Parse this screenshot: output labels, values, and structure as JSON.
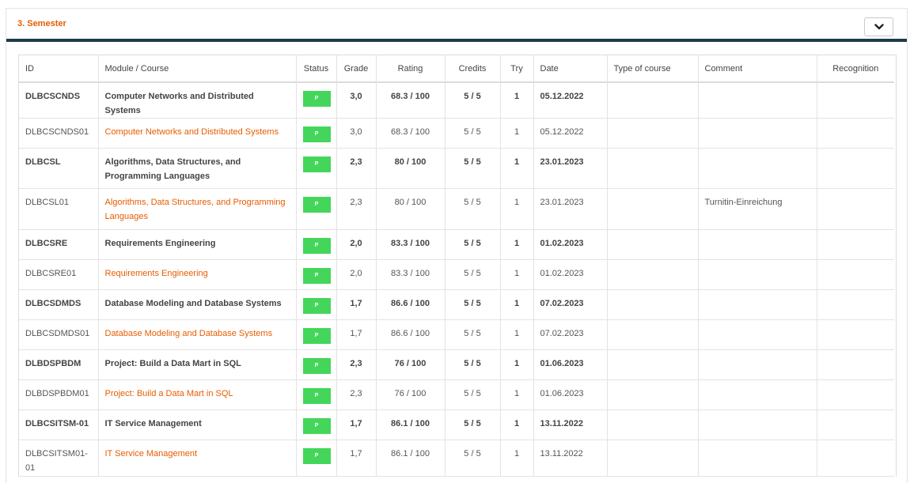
{
  "panel": {
    "title": "3. Semester"
  },
  "columns": {
    "id": "ID",
    "module": "Module / Course",
    "status": "Status",
    "grade": "Grade",
    "rating": "Rating",
    "credits": "Credits",
    "try": "Try",
    "date": "Date",
    "type": "Type of course",
    "comment": "Comment",
    "recognition": "Recognition"
  },
  "colors": {
    "accent": "#e65c00",
    "header_rule": "#1d3c4a",
    "status_passed": "#44d65a"
  },
  "rows": [
    {
      "kind": "module",
      "id": "DLBCSCNDS",
      "name": "Computer Networks and Distributed Systems",
      "status": "P",
      "grade": "3,0",
      "rating": "68.3 / 100",
      "credits": "5 / 5",
      "try": "1",
      "date": "05.12.2022",
      "type": "",
      "comment": "",
      "recognition": ""
    },
    {
      "kind": "course",
      "id": "DLBCSCNDS01",
      "name": "Computer Networks and Distributed Systems",
      "status": "P",
      "grade": "3,0",
      "rating": "68.3 / 100",
      "credits": "5 / 5",
      "try": "1",
      "date": "05.12.2022",
      "type": "",
      "comment": "",
      "recognition": ""
    },
    {
      "kind": "module",
      "id": "DLBCSL",
      "name": "Algorithms, Data Structures, and Programming Languages",
      "status": "P",
      "grade": "2,3",
      "rating": "80 / 100",
      "credits": "5 / 5",
      "try": "1",
      "date": "23.01.2023",
      "type": "",
      "comment": "",
      "recognition": ""
    },
    {
      "kind": "course",
      "id": "DLBCSL01",
      "name": "Algorithms, Data Structures, and Programming Languages",
      "status": "P",
      "grade": "2,3",
      "rating": "80 / 100",
      "credits": "5 / 5",
      "try": "1",
      "date": "23.01.2023",
      "type": "",
      "comment": "Turnitin-Einreichung",
      "recognition": ""
    },
    {
      "kind": "module",
      "id": "DLBCSRE",
      "name": "Requirements Engineering",
      "status": "P",
      "grade": "2,0",
      "rating": "83.3 / 100",
      "credits": "5 / 5",
      "try": "1",
      "date": "01.02.2023",
      "type": "",
      "comment": "",
      "recognition": ""
    },
    {
      "kind": "course",
      "id": "DLBCSRE01",
      "name": "Requirements Engineering",
      "status": "P",
      "grade": "2,0",
      "rating": "83.3 / 100",
      "credits": "5 / 5",
      "try": "1",
      "date": "01.02.2023",
      "type": "",
      "comment": "",
      "recognition": ""
    },
    {
      "kind": "module",
      "id": "DLBCSDMDS",
      "name": "Database Modeling and Database Systems",
      "status": "P",
      "grade": "1,7",
      "rating": "86.6 / 100",
      "credits": "5 / 5",
      "try": "1",
      "date": "07.02.2023",
      "type": "",
      "comment": "",
      "recognition": ""
    },
    {
      "kind": "course",
      "id": "DLBCSDMDS01",
      "name": "Database Modeling and Database Systems",
      "status": "P",
      "grade": "1,7",
      "rating": "86.6 / 100",
      "credits": "5 / 5",
      "try": "1",
      "date": "07.02.2023",
      "type": "",
      "comment": "",
      "recognition": ""
    },
    {
      "kind": "module",
      "id": "DLBDSPBDM",
      "name": "Project: Build a Data Mart in SQL",
      "status": "P",
      "grade": "2,3",
      "rating": "76 / 100",
      "credits": "5 / 5",
      "try": "1",
      "date": "01.06.2023",
      "type": "",
      "comment": "",
      "recognition": ""
    },
    {
      "kind": "course",
      "id": "DLBDSPBDM01",
      "name": "Project: Build a Data Mart in SQL",
      "status": "P",
      "grade": "2,3",
      "rating": "76 / 100",
      "credits": "5 / 5",
      "try": "1",
      "date": "01.06.2023",
      "type": "",
      "comment": "",
      "recognition": ""
    },
    {
      "kind": "module",
      "id": "DLBCSITSM-01",
      "name": "IT Service Management",
      "status": "P",
      "grade": "1,7",
      "rating": "86.1 / 100",
      "credits": "5 / 5",
      "try": "1",
      "date": "13.11.2022",
      "type": "",
      "comment": "",
      "recognition": ""
    },
    {
      "kind": "course",
      "id": "DLBCSITSM01-01",
      "name": "IT Service Management",
      "status": "P",
      "grade": "1,7",
      "rating": "86.1 / 100",
      "credits": "5 / 5",
      "try": "1",
      "date": "13.11.2022",
      "type": "",
      "comment": "",
      "recognition": ""
    }
  ]
}
